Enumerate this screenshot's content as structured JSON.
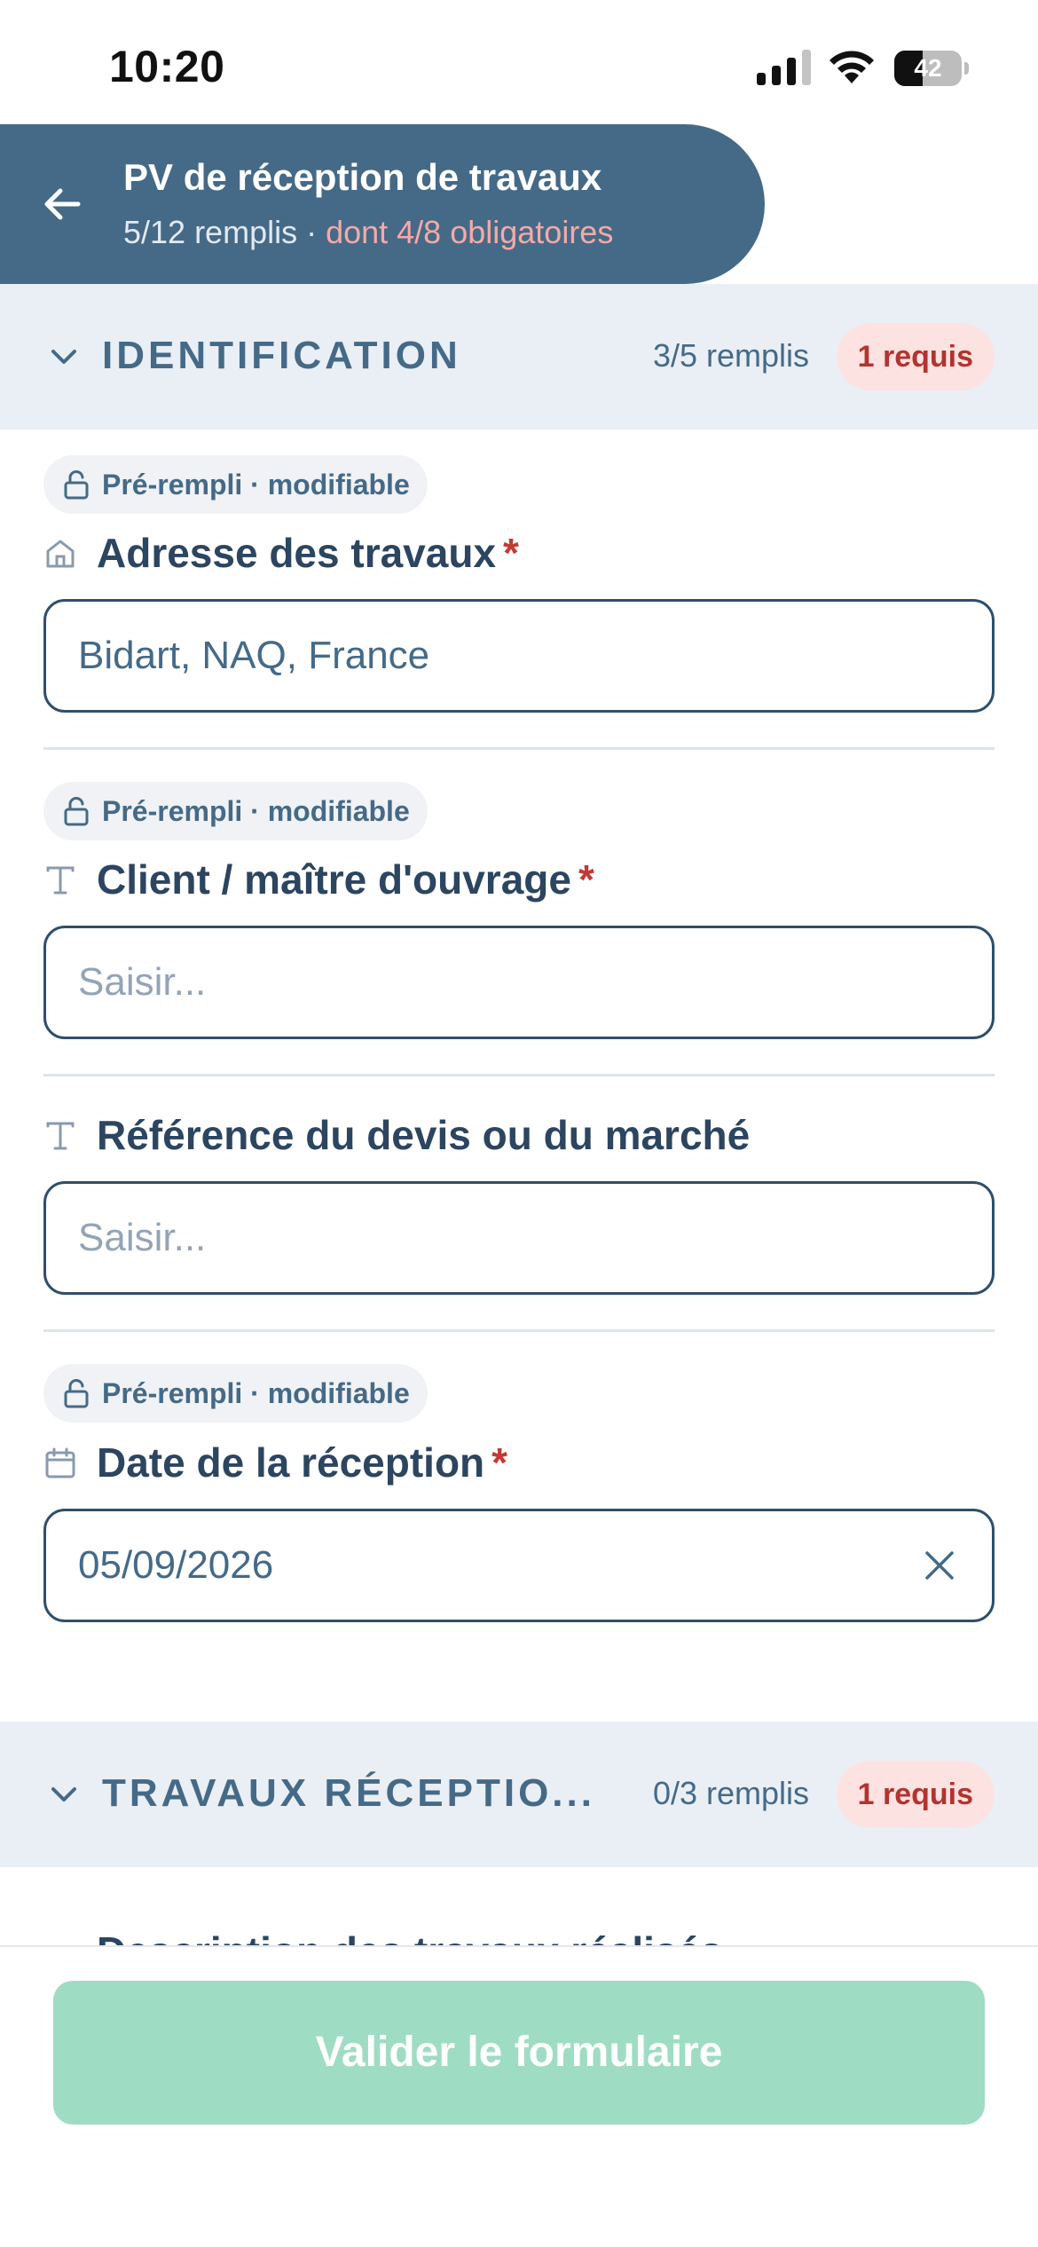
{
  "status_bar": {
    "time": "10:20",
    "battery": "42",
    "battery_level": 0.42
  },
  "header": {
    "title": "PV de réception de travaux",
    "progress": "5/12 remplis",
    "separator": " · ",
    "required_progress": "dont 4/8 obligatoires"
  },
  "sections": [
    {
      "title": "IDENTIFICATION",
      "count": "3/5 remplis",
      "badge": "1 requis"
    },
    {
      "title": "TRAVAUX RÉCEPTIO...",
      "count": "0/3 remplis",
      "badge": "1 requis"
    }
  ],
  "fields": [
    {
      "chip": "Pré-rempli · modifiable",
      "label": "Adresse des travaux",
      "required_mark": "*",
      "icon": "home-icon",
      "value": "Bidart, NAQ, France"
    },
    {
      "chip": "Pré-rempli · modifiable",
      "label": "Client / maître d'ouvrage",
      "required_mark": "*",
      "icon": "text-icon",
      "placeholder": "Saisir..."
    },
    {
      "label": "Référence du devis ou du marché",
      "icon": "text-icon",
      "placeholder": "Saisir..."
    },
    {
      "chip": "Pré-rempli · modifiable",
      "label": "Date de la réception",
      "required_mark": "*",
      "icon": "calendar-icon",
      "value": "05/09/2026"
    }
  ],
  "cutoff_text": "Description des travaux réalisés",
  "submit_label": "Valider le formulaire",
  "colors": {
    "header_bg": "#456a88",
    "section_bg": "#eaeff5",
    "badge_bg": "#fce3e1",
    "badge_text": "#b3332f",
    "submit_bg": "#9fdcc4",
    "required": "#c23a35"
  }
}
